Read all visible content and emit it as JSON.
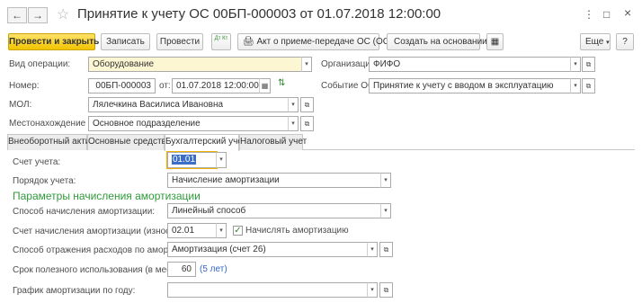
{
  "window": {
    "title": "Принятие к учету ОС 00БП-000003 от 01.07.2018 12:00:00",
    "back_icon": "←",
    "forward_icon": "→",
    "star_icon": "☆",
    "menu_icon": "⋮",
    "maximize_icon": "□",
    "close_icon": "×"
  },
  "toolbar": {
    "post_close": "Провести и закрыть",
    "save": "Записать",
    "post": "Провести",
    "dt_kt": "Дт Кт",
    "print_act": "Акт о приеме-передаче ОС (ОС-1)",
    "create_based": "Создать на основании",
    "more": "Еще",
    "help": "?"
  },
  "header": {
    "operation_label": "Вид операции:",
    "operation_value": "Оборудование",
    "org_label": "Организация:",
    "org_value": "ФИФО",
    "number_label": "Номер:",
    "number_value": "00БП-000003",
    "from_label": "от:",
    "date_value": "01.07.2018 12:00:00",
    "event_label": "Событие ОС:",
    "event_value": "Принятие к учету с вводом в эксплуатацию",
    "mol_label": "МОЛ:",
    "mol_value": "Лялечкина Василиса Ивановна",
    "location_label": "Местонахождение ОС:",
    "location_value": "Основное подразделение"
  },
  "tabs": [
    {
      "label": "Внеоборотный актив"
    },
    {
      "label": "Основные средства"
    },
    {
      "label": "Бухгалтерский учет"
    },
    {
      "label": "Налоговый учет"
    }
  ],
  "accounting": {
    "account_label": "Счет учета:",
    "account_value": "01.01",
    "procedure_label": "Порядок учета:",
    "procedure_value": "Начисление амортизации",
    "section_title": "Параметры начисления амортизации",
    "method_label": "Способ начисления амортизации:",
    "method_value": "Линейный способ",
    "depr_account_label": "Счет начисления амортизации (износа):",
    "depr_account_value": "02.01",
    "accrue_label": "Начислять амортизацию",
    "accrue_checked": true,
    "expense_method_label": "Способ отражения расходов по амортизации:",
    "expense_method_value": "Амортизация (счет 26)",
    "useful_life_label": "Срок полезного использования (в месяцах):",
    "useful_life_value": "60",
    "useful_life_years": "(5 лет)",
    "schedule_label": "График амортизации по году:",
    "schedule_value": ""
  }
}
